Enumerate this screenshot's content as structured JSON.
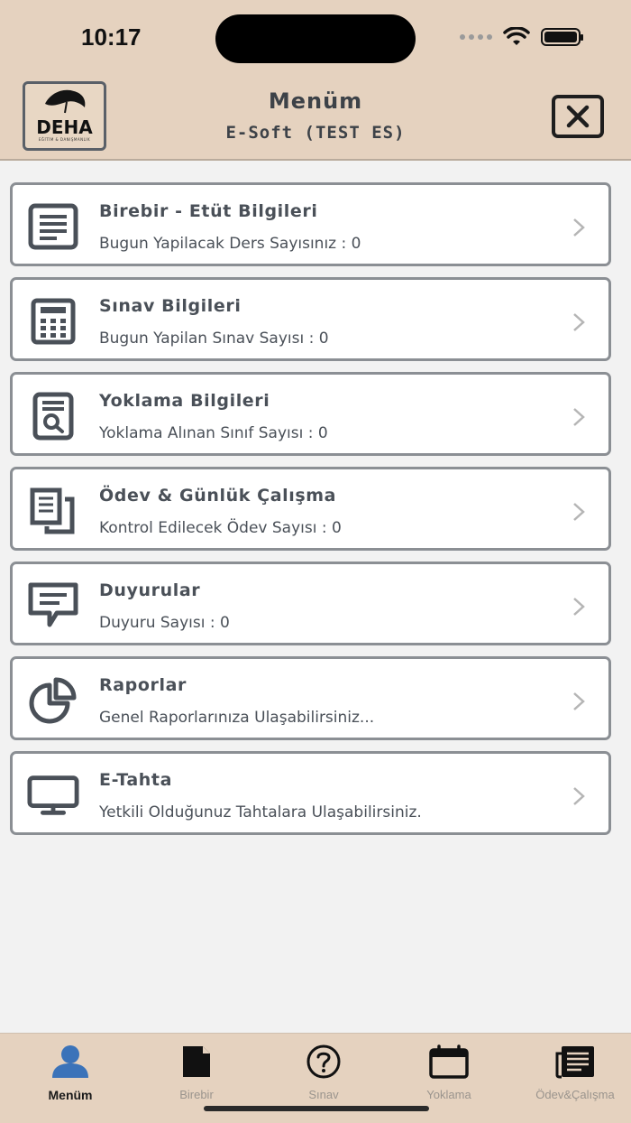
{
  "status": {
    "time": "10:17"
  },
  "header": {
    "title": "Menüm",
    "subtitle": "E-Soft (TEST ES)",
    "logo_text": "DEHA",
    "logo_subtext": "EĞİTİM & DANIŞMANLIK"
  },
  "menu": [
    {
      "title": "Birebir - Etüt Bilgileri",
      "subtitle": "Bugun Yapilacak Ders Sayısınız : 0",
      "icon": "document-lines-icon"
    },
    {
      "title": "Sınav Bilgileri",
      "subtitle": "Bugun Yapilan Sınav Sayısı : 0",
      "icon": "calculator-icon"
    },
    {
      "title": "Yoklama Bilgileri",
      "subtitle": "Yoklama Alınan Sınıf Sayısı : 0",
      "icon": "document-search-icon"
    },
    {
      "title": "Ödev & Günlük Çalışma",
      "subtitle": "Kontrol Edilecek Ödev Sayısı : 0",
      "icon": "copy-documents-icon"
    },
    {
      "title": "Duyurular",
      "subtitle": "Duyuru Sayısı : 0",
      "icon": "message-icon"
    },
    {
      "title": "Raporlar",
      "subtitle": "Genel Raporlarınıza Ulaşabilirsiniz...",
      "icon": "pie-chart-icon"
    },
    {
      "title": "E-Tahta",
      "subtitle": "Yetkili Olduğunuz Tahtalara Ulaşabilirsiniz.",
      "icon": "monitor-icon"
    }
  ],
  "tabs": [
    {
      "label": "Menüm",
      "icon": "user-icon",
      "active": true
    },
    {
      "label": "Birebir",
      "icon": "file-icon",
      "active": false
    },
    {
      "label": "Sınav",
      "icon": "question-icon",
      "active": false
    },
    {
      "label": "Yoklama",
      "icon": "calendar-icon",
      "active": false
    },
    {
      "label": "Ödev&Çalışma",
      "icon": "newspaper-icon",
      "active": false
    }
  ],
  "colors": {
    "header_bg": "#e5d2bf",
    "page_bg": "#f2f2f2",
    "text": "#4a5058",
    "active_tab_icon": "#3b73b9"
  }
}
